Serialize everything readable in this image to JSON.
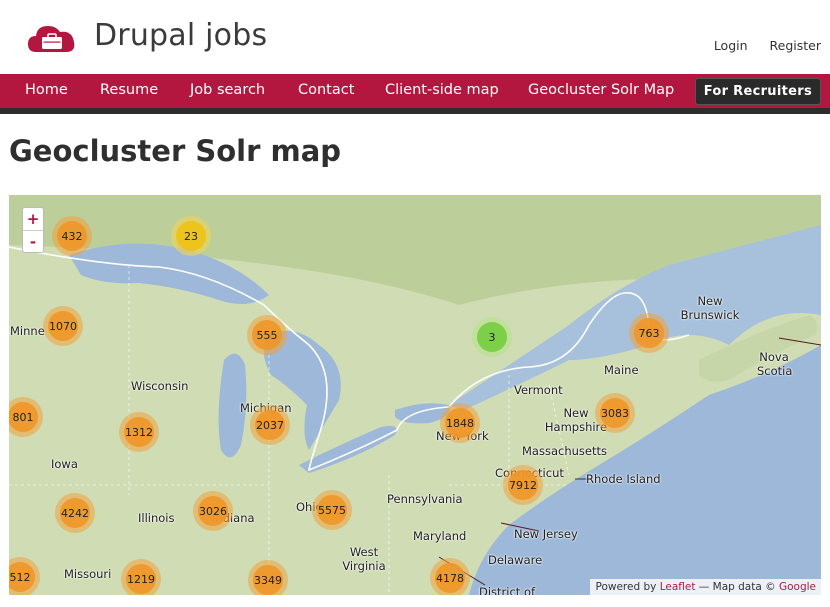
{
  "header": {
    "site_name": "Drupal jobs",
    "login": "Login",
    "register": "Register"
  },
  "nav": {
    "items": [
      "Home",
      "Resume",
      "Job search",
      "Contact",
      "Client-side map",
      "Geocluster Solr Map"
    ],
    "recruiters": "For Recruiters"
  },
  "page": {
    "title": "Geocluster Solr map"
  },
  "map": {
    "zoom_in": "+",
    "zoom_out": "-",
    "clusters": [
      "432",
      "23",
      "1070",
      "555",
      "3",
      "763",
      "801",
      "1312",
      "2037",
      "1848",
      "3083",
      "7912",
      "4242",
      "3026",
      "5575",
      "512",
      "1219",
      "3349",
      "4178"
    ],
    "places": [
      "Minne",
      "Wisconsin",
      "Michigan",
      "Iowa",
      "Illinois",
      "Indiana",
      "Ohio",
      "Missouri",
      "West Virginia",
      "Pennsylvania",
      "Maryland",
      "Delaware",
      "New Jersey",
      "New York",
      "Vermont",
      "New Hampshire",
      "Massachusetts",
      "Connecticut",
      "Rhode Island",
      "Maine",
      "New Brunswick",
      "Nova Scotia",
      "District of"
    ],
    "attribution": {
      "powered_by": "Powered by",
      "leaflet": "Leaflet",
      "map_data": "— Map data ©",
      "google": "Google"
    }
  },
  "colors": {
    "brand": "#b3173f",
    "nav_dark": "#2d2d2d"
  }
}
